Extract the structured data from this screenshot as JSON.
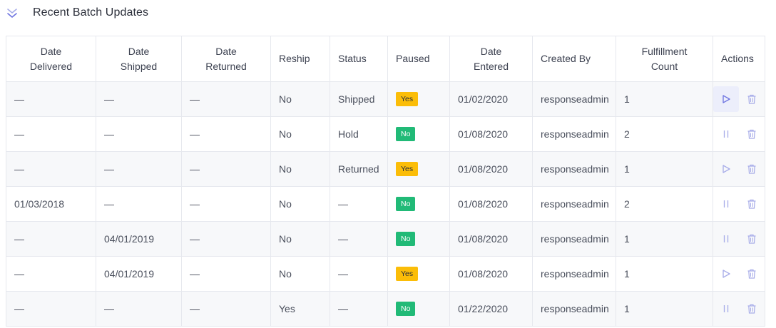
{
  "header": {
    "title": "Recent Batch Updates",
    "icon": "double-chevron-down-icon"
  },
  "colors": {
    "accent": "#6c72e0",
    "yes_badge": "#fbbd08",
    "no_badge": "#21ba77",
    "icon_muted": "#a6abe8"
  },
  "table": {
    "columns": [
      {
        "l1": "Date",
        "l2": "Delivered"
      },
      {
        "l1": "Date",
        "l2": "Shipped"
      },
      {
        "l1": "Date",
        "l2": "Returned"
      },
      {
        "l1": "Reship",
        "l2": ""
      },
      {
        "l1": "Status",
        "l2": ""
      },
      {
        "l1": "Paused",
        "l2": ""
      },
      {
        "l1": "Date",
        "l2": "Entered"
      },
      {
        "l1": "Created By",
        "l2": ""
      },
      {
        "l1": "Fulfillment",
        "l2": "Count"
      },
      {
        "l1": "Actions",
        "l2": ""
      }
    ],
    "rows": [
      {
        "delivered": "—",
        "shipped": "—",
        "returned": "—",
        "reship": "No",
        "status": "Shipped",
        "paused": "Yes",
        "entered": "01/02/2020",
        "created_by": "responseadmin",
        "count": "1",
        "action_icon": "play-icon"
      },
      {
        "delivered": "—",
        "shipped": "—",
        "returned": "—",
        "reship": "No",
        "status": "Hold",
        "paused": "No",
        "entered": "01/08/2020",
        "created_by": "responseadmin",
        "count": "2",
        "action_icon": "pause-icon"
      },
      {
        "delivered": "—",
        "shipped": "—",
        "returned": "—",
        "reship": "No",
        "status": "Returned",
        "paused": "Yes",
        "entered": "01/08/2020",
        "created_by": "responseadmin",
        "count": "1",
        "action_icon": "play-icon"
      },
      {
        "delivered": "01/03/2018",
        "shipped": "—",
        "returned": "—",
        "reship": "No",
        "status": "—",
        "paused": "No",
        "entered": "01/08/2020",
        "created_by": "responseadmin",
        "count": "2",
        "action_icon": "pause-icon"
      },
      {
        "delivered": "—",
        "shipped": "04/01/2019",
        "returned": "—",
        "reship": "No",
        "status": "—",
        "paused": "No",
        "entered": "01/08/2020",
        "created_by": "responseadmin",
        "count": "1",
        "action_icon": "pause-icon"
      },
      {
        "delivered": "—",
        "shipped": "04/01/2019",
        "returned": "—",
        "reship": "No",
        "status": "—",
        "paused": "Yes",
        "entered": "01/08/2020",
        "created_by": "responseadmin",
        "count": "1",
        "action_icon": "play-icon"
      },
      {
        "delivered": "—",
        "shipped": "—",
        "returned": "—",
        "reship": "Yes",
        "status": "—",
        "paused": "No",
        "entered": "01/22/2020",
        "created_by": "responseadmin",
        "count": "1",
        "action_icon": "pause-icon"
      }
    ]
  }
}
